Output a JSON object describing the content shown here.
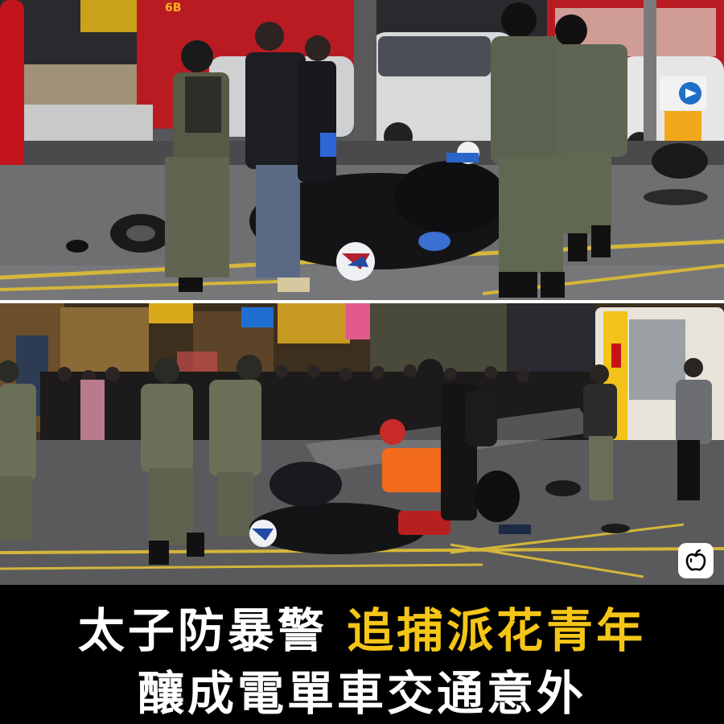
{
  "photos": {
    "top": {
      "description_label": ""
    },
    "bottom": {
      "description_label": ""
    }
  },
  "signs": {
    "bus_display": "6B"
  },
  "caption": {
    "line1_white": "太子防暴警",
    "line1_yellow": "追捕派花青年",
    "line2": "釀成電單車交通意外"
  },
  "colors": {
    "caption_highlight": "#f5c518",
    "caption_text": "#ffffff",
    "caption_background": "#000000"
  },
  "icons": {
    "brand_logo": "apple-logo-icon",
    "direction_sign": "right-arrow-sign-icon"
  }
}
